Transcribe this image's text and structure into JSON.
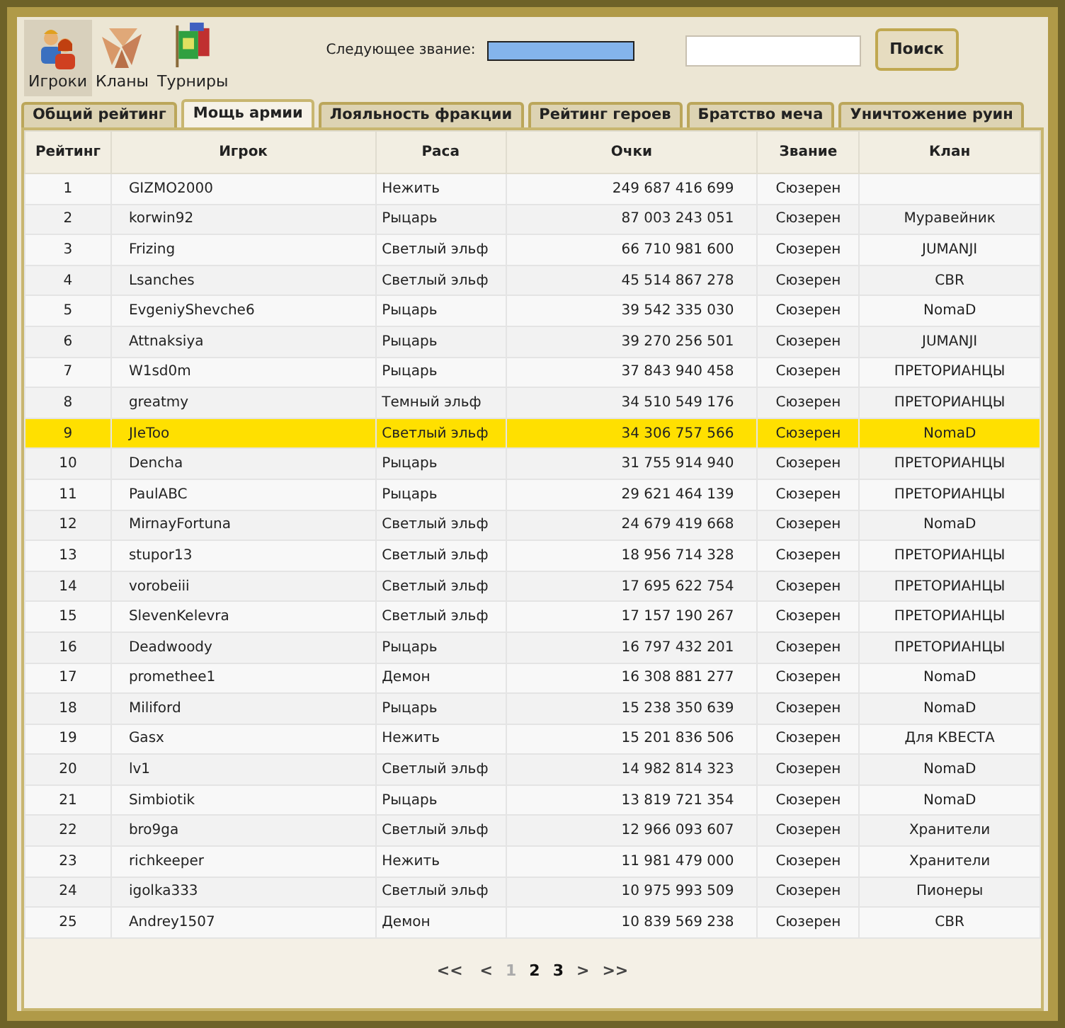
{
  "nav": [
    {
      "label": "Игроки",
      "kind": "players",
      "selected": true
    },
    {
      "label": "Кланы",
      "kind": "clans",
      "selected": false
    },
    {
      "label": "Турниры",
      "kind": "tournaments",
      "selected": false
    }
  ],
  "next_rank": {
    "label": "Следующее звание:",
    "level": 1
  },
  "search": {
    "button": "Поиск"
  },
  "tabs": [
    {
      "label": "Общий рейтинг",
      "selected": false
    },
    {
      "label": "Мощь армии",
      "selected": true
    },
    {
      "label": "Лояльность фракции",
      "selected": false
    },
    {
      "label": "Рейтинг героев",
      "selected": false
    },
    {
      "label": "Братство меча",
      "selected": false
    },
    {
      "label": "Уничтожение руин",
      "selected": false
    }
  ],
  "table": {
    "columns": [
      "Рейтинг",
      "Игрок",
      "Раса",
      "Очки",
      "Звание",
      "Клан"
    ],
    "rows": [
      {
        "cells": [
          "1",
          "GIZMO2000",
          "Нежить",
          "249 687 416 699",
          "Сюзерен",
          ""
        ],
        "selected": false
      },
      {
        "cells": [
          "2",
          "korwin92",
          "Рыцарь",
          "87 003 243 051",
          "Сюзерен",
          "Муравейник"
        ],
        "selected": false
      },
      {
        "cells": [
          "3",
          "Frizing",
          "Светлый эльф",
          "66 710 981 600",
          "Сюзерен",
          "JUMANJI"
        ],
        "selected": false
      },
      {
        "cells": [
          "4",
          "Lsanches",
          "Светлый эльф",
          "45 514 867 278",
          "Сюзерен",
          "CBR"
        ],
        "selected": false
      },
      {
        "cells": [
          "5",
          "EvgeniyShevche6",
          "Рыцарь",
          "39 542 335 030",
          "Сюзерен",
          "NomaD"
        ],
        "selected": false
      },
      {
        "cells": [
          "6",
          "Attnaksiya",
          "Рыцарь",
          "39 270 256 501",
          "Сюзерен",
          "JUMANJI"
        ],
        "selected": false
      },
      {
        "cells": [
          "7",
          "W1sd0m",
          "Рыцарь",
          "37 843 940 458",
          "Сюзерен",
          "ПРЕТОРИАНЦЫ"
        ],
        "selected": false
      },
      {
        "cells": [
          "8",
          "greatmy",
          "Темный эльф",
          "34 510 549 176",
          "Сюзерен",
          "ПРЕТОРИАНЦЫ"
        ],
        "selected": false
      },
      {
        "cells": [
          "9",
          "JIeToo",
          "Светлый эльф",
          "34 306 757 566",
          "Сюзерен",
          "NomaD"
        ],
        "selected": true
      },
      {
        "cells": [
          "10",
          "Dencha",
          "Рыцарь",
          "31 755 914 940",
          "Сюзерен",
          "ПРЕТОРИАНЦЫ"
        ],
        "selected": false
      },
      {
        "cells": [
          "11",
          "PaulABC",
          "Рыцарь",
          "29 621 464 139",
          "Сюзерен",
          "ПРЕТОРИАНЦЫ"
        ],
        "selected": false
      },
      {
        "cells": [
          "12",
          "MirnayFortuna",
          "Светлый эльф",
          "24 679 419 668",
          "Сюзерен",
          "NomaD"
        ],
        "selected": false
      },
      {
        "cells": [
          "13",
          "stupor13",
          "Светлый эльф",
          "18 956 714 328",
          "Сюзерен",
          "ПРЕТОРИАНЦЫ"
        ],
        "selected": false
      },
      {
        "cells": [
          "14",
          "vorobeiii",
          "Светлый эльф",
          "17 695 622 754",
          "Сюзерен",
          "ПРЕТОРИАНЦЫ"
        ],
        "selected": false
      },
      {
        "cells": [
          "15",
          "SlevenKelevra",
          "Светлый эльф",
          "17 157 190 267",
          "Сюзерен",
          "ПРЕТОРИАНЦЫ"
        ],
        "selected": false
      },
      {
        "cells": [
          "16",
          "Deadwoody",
          "Рыцарь",
          "16 797 432 201",
          "Сюзерен",
          "ПРЕТОРИАНЦЫ"
        ],
        "selected": false
      },
      {
        "cells": [
          "17",
          "promethee1",
          "Демон",
          "16 308 881 277",
          "Сюзерен",
          "NomaD"
        ],
        "selected": false
      },
      {
        "cells": [
          "18",
          "Miliford",
          "Рыцарь",
          "15 238 350 639",
          "Сюзерен",
          "NomaD"
        ],
        "selected": false
      },
      {
        "cells": [
          "19",
          "Gasx",
          "Нежить",
          "15 201 836 506",
          "Сюзерен",
          "Для КВЕСТА"
        ],
        "selected": false
      },
      {
        "cells": [
          "20",
          "lv1",
          "Светлый эльф",
          "14 982 814 323",
          "Сюзерен",
          "NomaD"
        ],
        "selected": false
      },
      {
        "cells": [
          "21",
          "Simbiotik",
          "Рыцарь",
          "13 819 721 354",
          "Сюзерен",
          "NomaD"
        ],
        "selected": false
      },
      {
        "cells": [
          "22",
          "bro9ga",
          "Светлый эльф",
          "12 966 093 607",
          "Сюзерен",
          "Хранители"
        ],
        "selected": false
      },
      {
        "cells": [
          "23",
          "richkeeper",
          "Нежить",
          "11 981 479 000",
          "Сюзерен",
          "Хранители"
        ],
        "selected": false
      },
      {
        "cells": [
          "24",
          "igolka333",
          "Светлый эльф",
          "10 975 993 509",
          "Сюзерен",
          "Пионеры"
        ],
        "selected": false
      },
      {
        "cells": [
          "25",
          "Andrey1507",
          "Демон",
          "10 839 569 238",
          "Сюзерен",
          "CBR"
        ],
        "selected": false
      }
    ]
  },
  "pager": {
    "first": "<<",
    "prev": "<",
    "pages": [
      {
        "label": "1",
        "selected": true
      },
      {
        "label": "2",
        "selected": false
      },
      {
        "label": "3",
        "selected": false
      }
    ],
    "next": ">",
    "last": ">>"
  }
}
